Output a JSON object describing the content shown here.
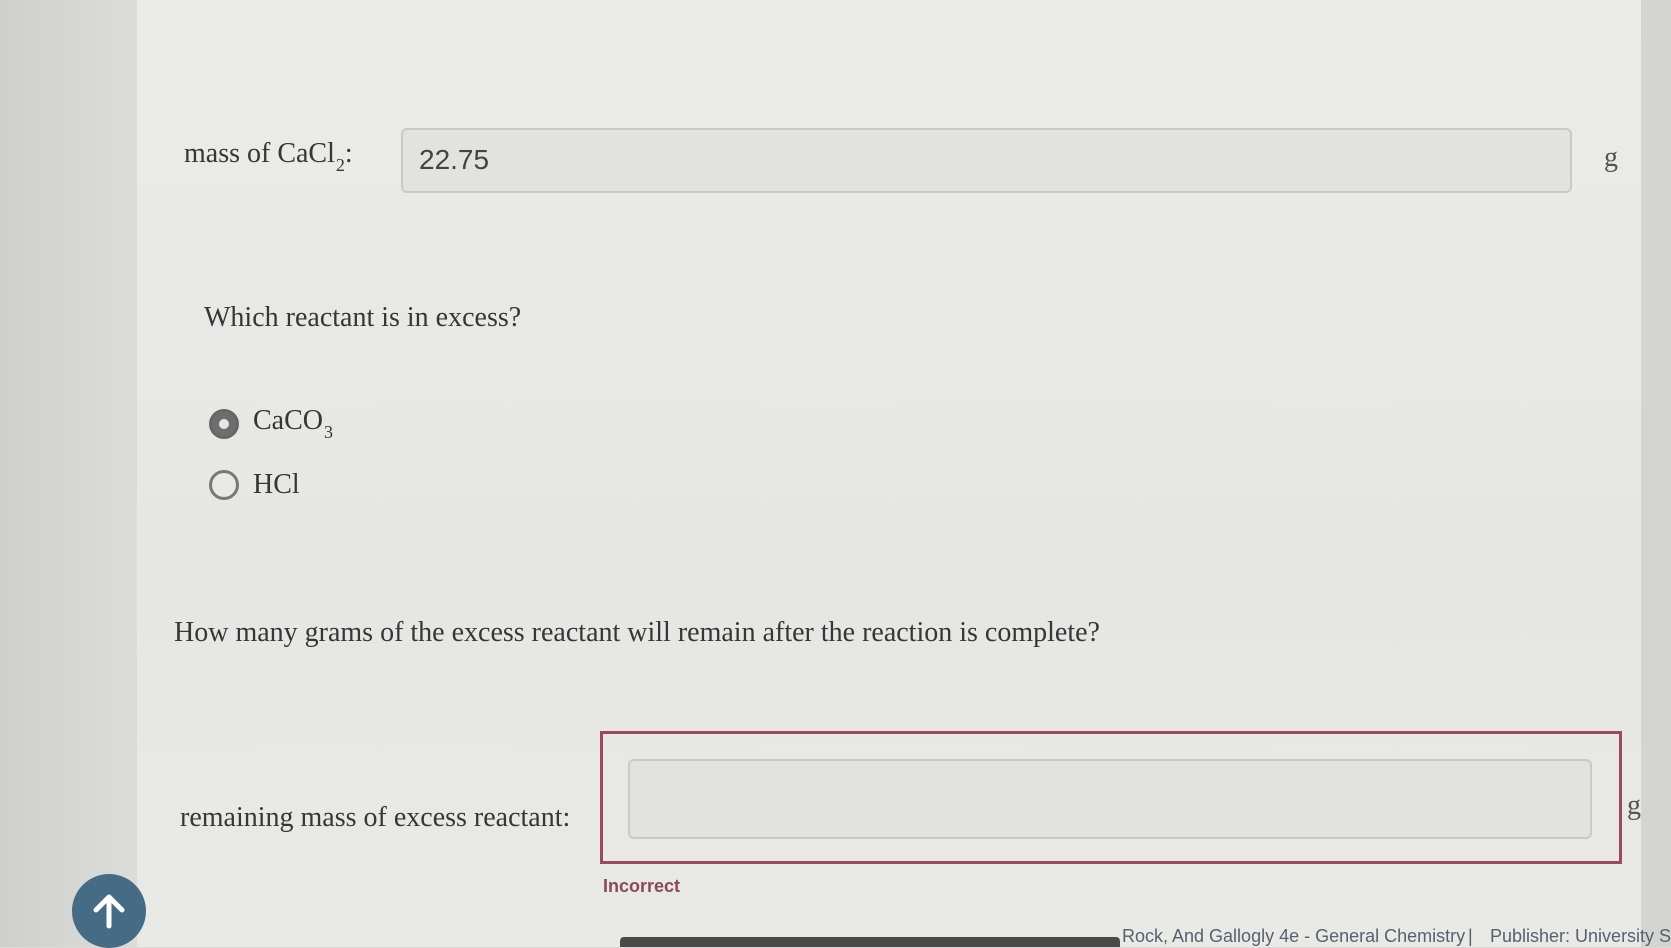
{
  "question1": {
    "label": "mass of CaCl",
    "label_sub": "2",
    "label_suffix": ":",
    "value": "22.75",
    "unit": "g"
  },
  "question2": {
    "prompt": "Which reactant is in excess?",
    "options": [
      {
        "label": "CaCO",
        "sub": "3",
        "selected": true
      },
      {
        "label": "HCl",
        "sub": "",
        "selected": false
      }
    ]
  },
  "question3": {
    "prompt": "How many grams of the excess reactant will remain after the reaction is complete?",
    "label": "remaining mass of excess reactant:",
    "value": "",
    "unit": "g",
    "status": "Incorrect"
  },
  "footer": {
    "book": "Rock, And Gallogly 4e - General Chemistry",
    "separator": "|",
    "publisher": "Publisher: University Sc"
  },
  "icons": {
    "scroll_top": "arrow-up-icon"
  }
}
